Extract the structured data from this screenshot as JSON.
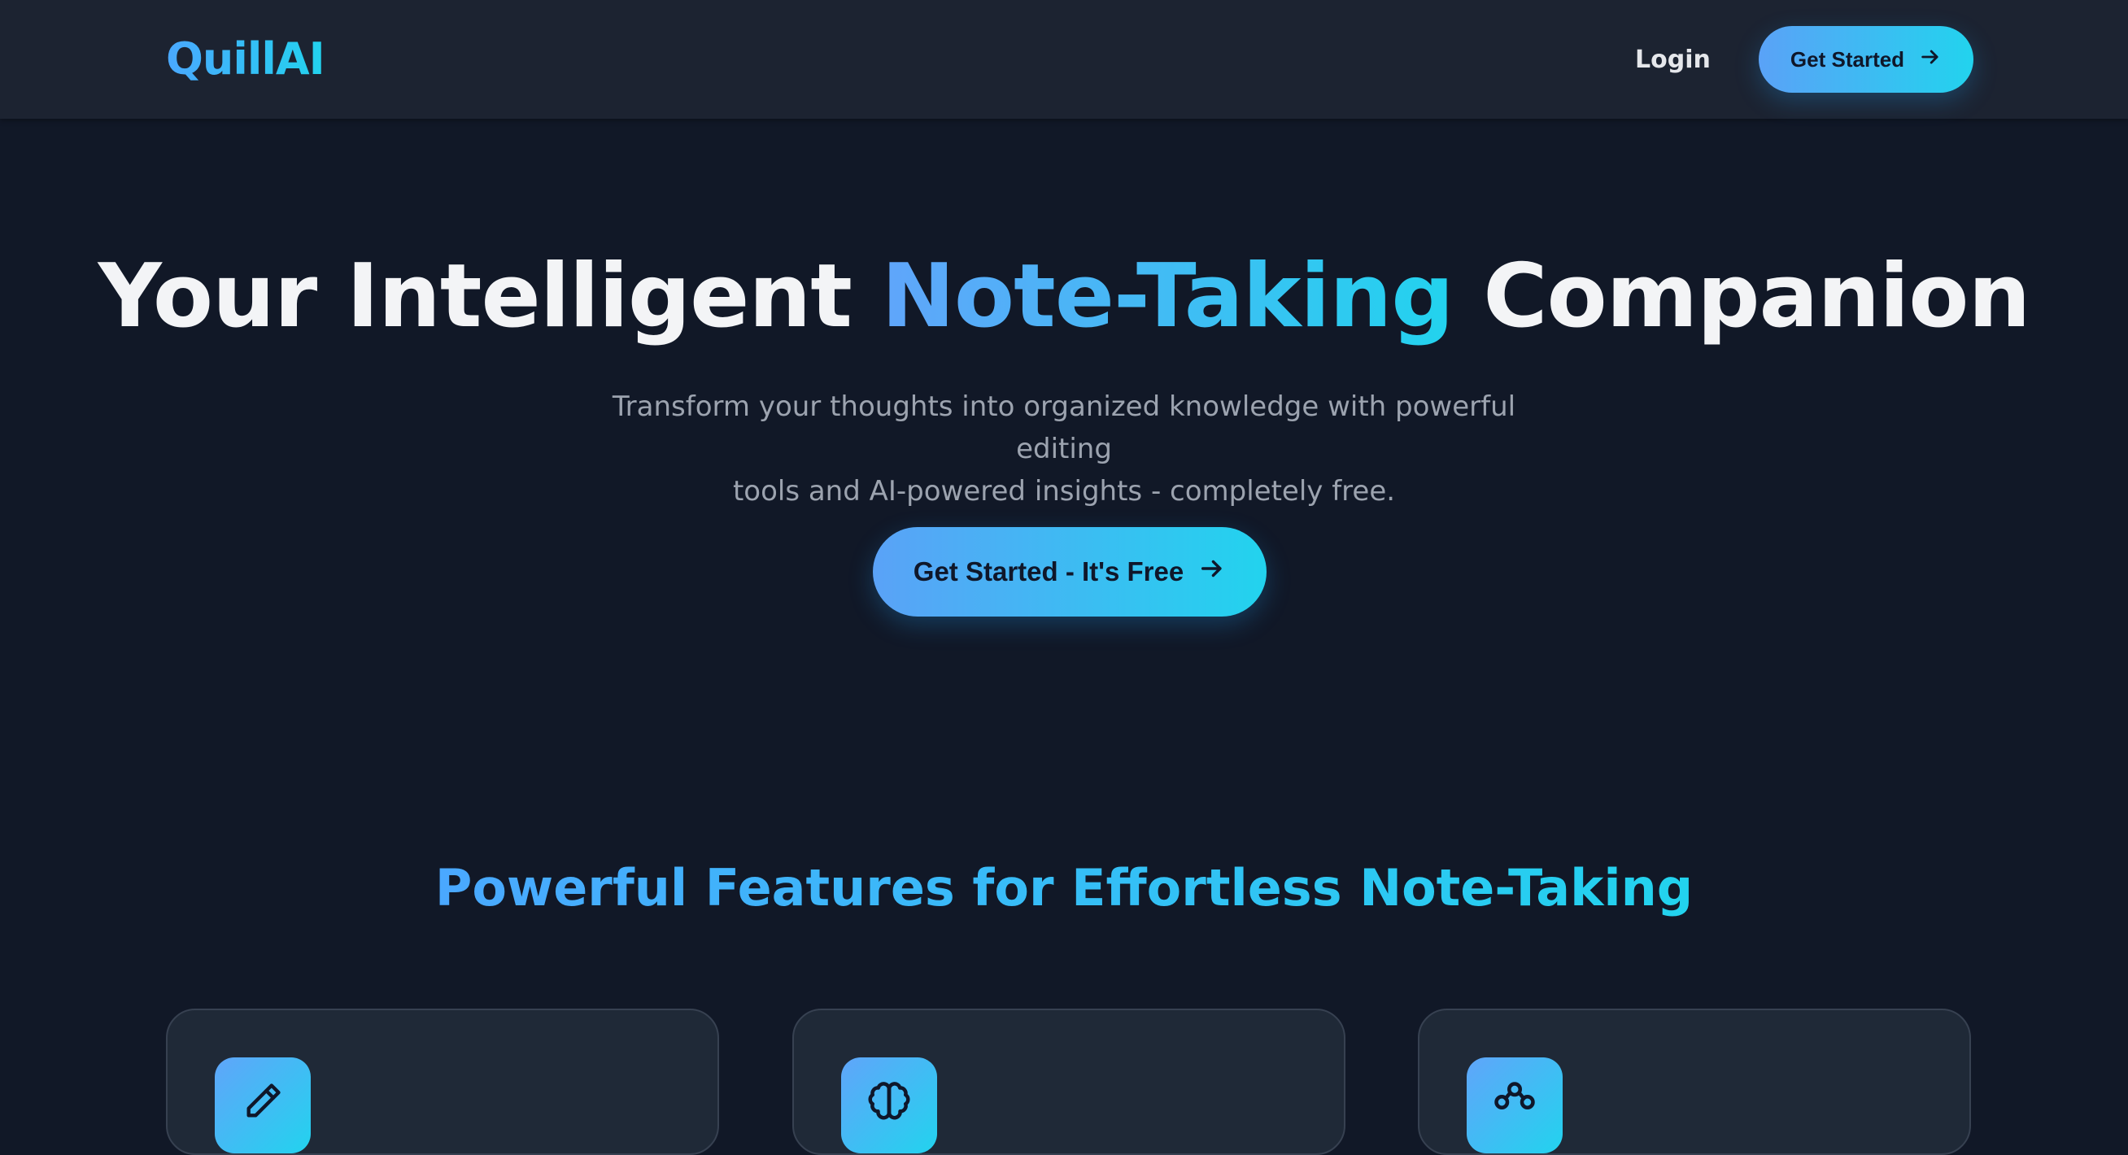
{
  "nav": {
    "logo": "QuillAI",
    "login_label": "Login",
    "cta_label": "Get Started",
    "cta_icon": "arrow-right-icon"
  },
  "hero": {
    "title_before": "Your Intelligent",
    "title_accent": "Note-Taking",
    "title_after": "Companion",
    "subtitle_line1": "Transform your thoughts into organized knowledge with powerful editing",
    "subtitle_line2": "tools and AI-powered insights - completely free.",
    "cta_label": "Get Started - It's Free",
    "cta_icon": "arrow-right-icon"
  },
  "features": {
    "title": "Powerful Features for Effortless Note-Taking",
    "cards": [
      {
        "icon": "pencil-icon"
      },
      {
        "icon": "brain-icon"
      },
      {
        "icon": "network-icon"
      }
    ]
  },
  "colors": {
    "background": "#111827",
    "header": "#1c2331",
    "accent_start": "#60a5fa",
    "accent_end": "#22d3ee",
    "card": "#1f2937"
  }
}
